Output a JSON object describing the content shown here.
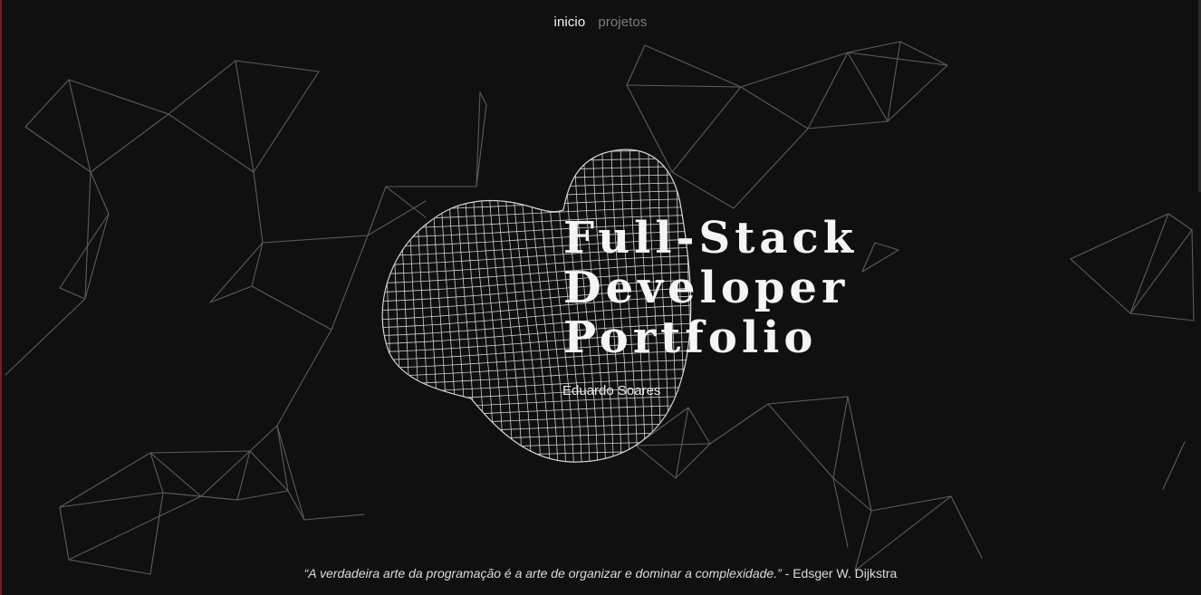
{
  "nav": {
    "items": [
      {
        "label": "inicio",
        "active": true
      },
      {
        "label": "projetos",
        "active": false
      }
    ]
  },
  "hero": {
    "title_lines": [
      "Full-Stack",
      "Developer",
      "Portfolio"
    ],
    "author": "Eduardo Soares"
  },
  "footer_quote": {
    "text": "“A verdadeira arte da programação é a arte de organizar e dominar a complexidade.”",
    "attribution": "- Edsger W. Dijkstra"
  },
  "colors": {
    "background": "#101010",
    "line": "#6a6a6a",
    "blob_mesh": "#d8d8d8",
    "accent": "#7a1c24"
  }
}
